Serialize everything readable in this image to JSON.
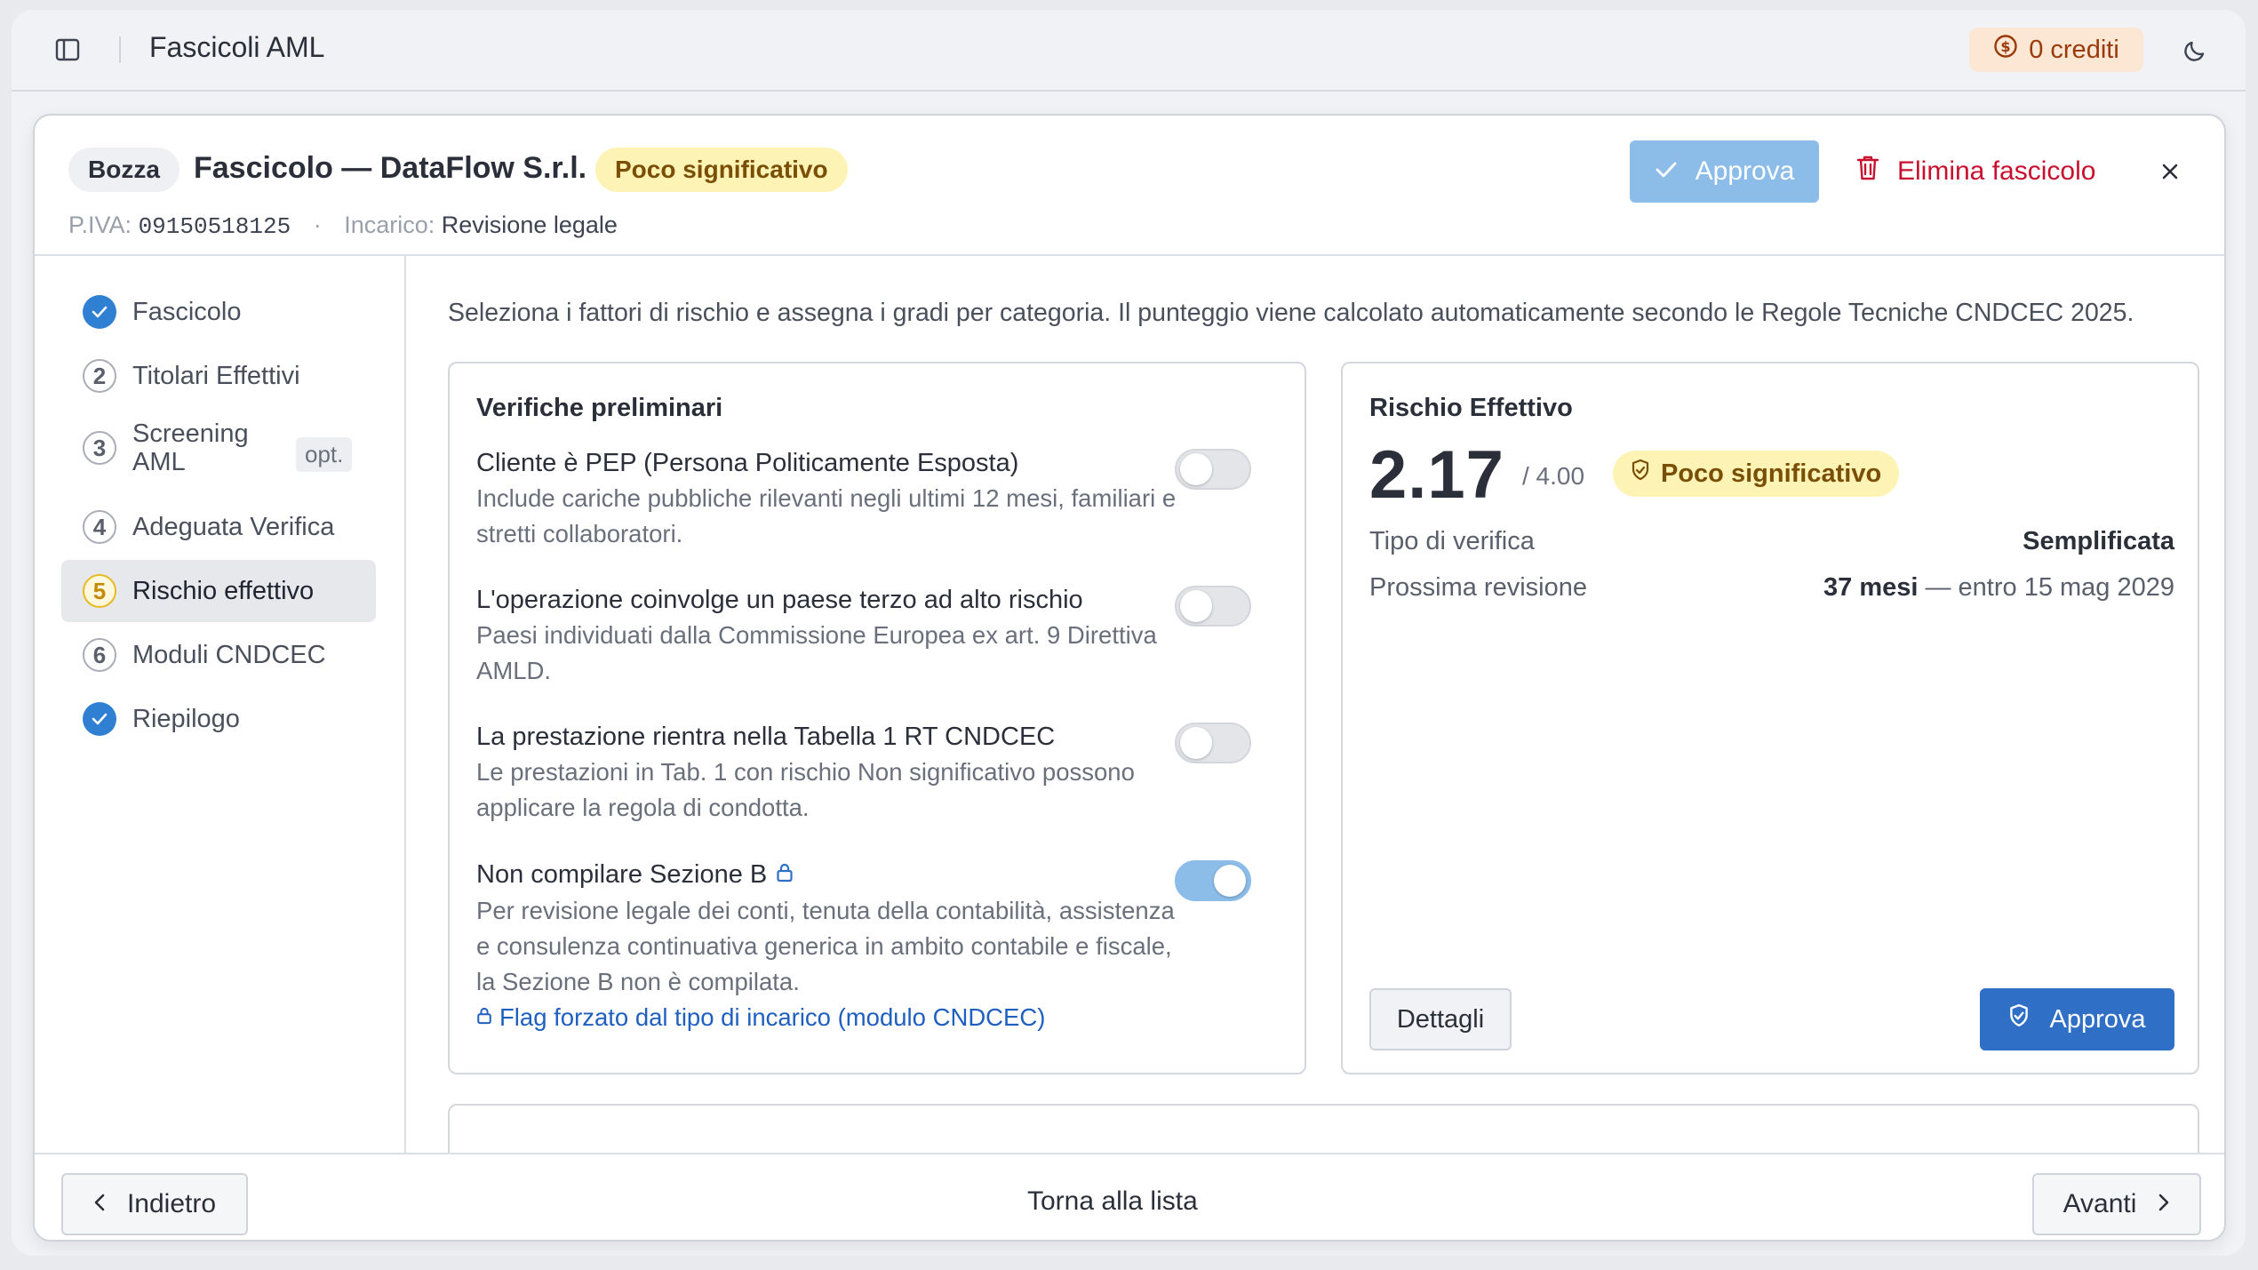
{
  "app": {
    "title": "Fascicoli AML",
    "credits": "0 crediti",
    "icons": [
      "sidebar-toggle-icon",
      "coin-icon",
      "moon-icon"
    ]
  },
  "header": {
    "status_badge": "Bozza",
    "title": "Fascicolo — DataFlow S.r.l.",
    "risk_badge": "Poco significativo",
    "piva_label": "P.IVA:",
    "piva_value": "09150518125",
    "separator": "·",
    "incarico_label": "Incarico:",
    "incarico_value": "Revisione legale",
    "approve_label": "Approva",
    "delete_label": "Elimina fascicolo"
  },
  "nav": {
    "items": [
      {
        "step": "",
        "label": "Fascicolo",
        "state": "done"
      },
      {
        "step": "2",
        "label": "Titolari Effettivi",
        "state": "todo"
      },
      {
        "step": "3",
        "label": "Screening AML",
        "state": "todo",
        "tag": "opt."
      },
      {
        "step": "4",
        "label": "Adeguata Verifica",
        "state": "todo"
      },
      {
        "step": "5",
        "label": "Rischio effettivo",
        "state": "current"
      },
      {
        "step": "6",
        "label": "Moduli CNDCEC",
        "state": "todo"
      },
      {
        "step": "",
        "label": "Riepilogo",
        "state": "done"
      }
    ]
  },
  "main": {
    "intro": "Seleziona i fattori di rischio e assegna i gradi per categoria. Il punteggio viene calcolato automaticamente secondo le Regole Tecniche CNDCEC 2025.",
    "preliminary": {
      "title": "Verifiche preliminari",
      "options": [
        {
          "title": "Cliente è PEP (Persona Politicamente Esposta)",
          "desc": "Include cariche pubbliche rilevanti negli ultimi 12 mesi, familiari e stretti collaboratori.",
          "checked": false
        },
        {
          "title": "L'operazione coinvolge un paese terzo ad alto rischio",
          "desc": "Paesi individuati dalla Commissione Europea ex art. 9 Direttiva AMLD.",
          "checked": false
        },
        {
          "title": "La prestazione rientra nella Tabella 1 RT CNDCEC",
          "desc": "Le prestazioni in Tab. 1 con rischio Non significativo possono applicare la regola di condotta.",
          "checked": false
        },
        {
          "title": "Non compilare Sezione B",
          "desc": "Per revisione legale dei conti, tenuta della contabilità, assistenza e consulenza continuativa generica in ambito contabile e fiscale, la Sezione B non è compilata.",
          "checked": true,
          "forced_note": "Flag forzato dal tipo di incarico (modulo CNDCEC)"
        }
      ]
    },
    "risk": {
      "title": "Rischio Effettivo",
      "score": "2.17",
      "score_max": "/ 4.00",
      "badge": "Poco significativo",
      "verification_label": "Tipo di verifica",
      "verification_value": "Semplificata",
      "review_label": "Prossima revisione",
      "review_value_bold": "37 mesi",
      "review_value_rest": " — entro 15 mag 2029",
      "details_label": "Dettagli",
      "approve_label": "Approva"
    }
  },
  "footer": {
    "back_label": "Indietro",
    "list_label": "Torna alla lista",
    "next_label": "Avanti"
  },
  "colors": {
    "primary": "#2f6fc6",
    "primary_disabled": "#8cbde8",
    "danger": "#c8102e",
    "warning_bg": "#fdf3b5",
    "warning_text": "#7a4f05",
    "credits_bg": "#fbe7d4"
  }
}
